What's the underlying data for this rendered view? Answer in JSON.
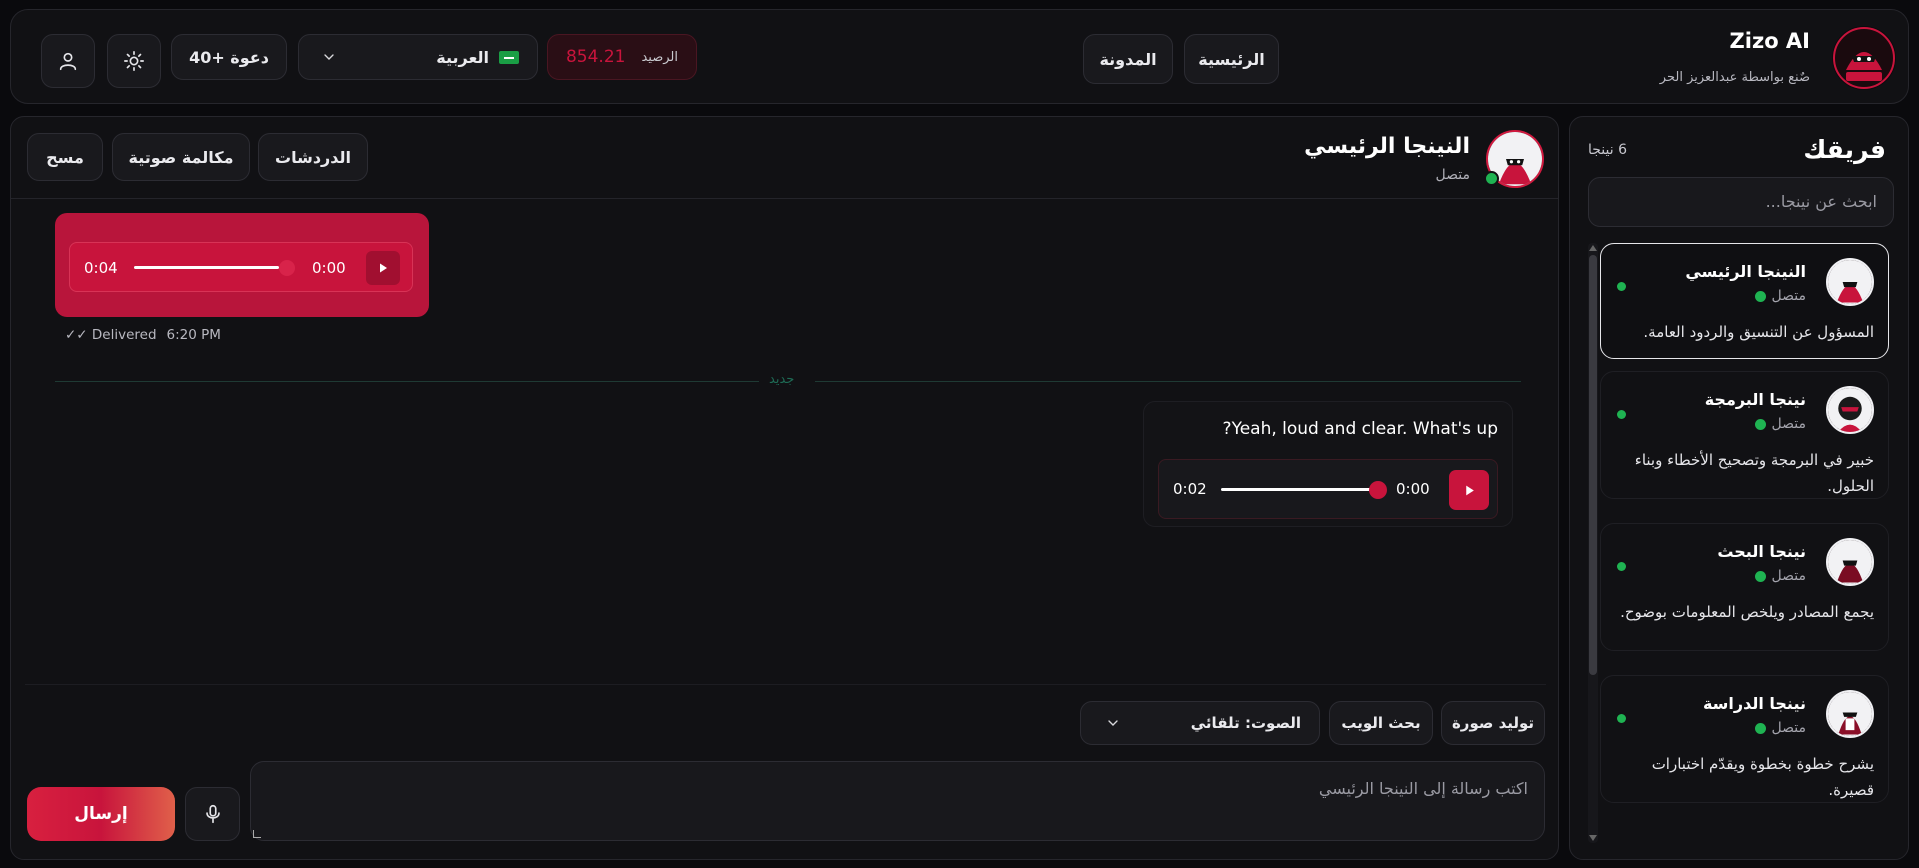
{
  "brand": {
    "name": "Zizo AI",
    "tagline": "صٌنع بواسطة عبدالعزيز الحر",
    "logo_text": "Zizo AI"
  },
  "nav": {
    "home": "الرئيسية",
    "blog": "المدونة"
  },
  "balance": {
    "label": "الرصيد",
    "value": "854.21"
  },
  "language": {
    "selected": "العربية",
    "flag": "saudi-flag"
  },
  "invite": "دعوة +40",
  "icons": {
    "theme": "sun-icon",
    "profile": "user-icon"
  },
  "chat": {
    "agent_name": "النينجا الرئيسي",
    "agent_status": "متصل",
    "actions": {
      "chats": "الدردشات",
      "voice_call": "مكالمة صوتية",
      "clear": "مسح"
    },
    "messages": [
      {
        "kind": "user-voice",
        "current": "0:00",
        "duration": "0:04",
        "progress": 0.05,
        "meta_time": "6:20 PM",
        "meta_status": "✓✓ Delivered"
      },
      {
        "kind": "agent-voice",
        "text": "Yeah, loud and clear. What's up?",
        "current": "0:00",
        "duration": "0:02",
        "progress": 0.0
      }
    ],
    "divider_label": "جديد",
    "tools": {
      "generate_image": "توليد صورة",
      "web_search": "بحث الويب",
      "voice_select": "الصوت: تلقائي"
    },
    "input_placeholder": "اكتب رسالة إلى النينجا الرئيسي",
    "send": "إرسال"
  },
  "team": {
    "title": "فريقك",
    "count": "6 نينجا",
    "search_placeholder": "ابحث عن نينجا...",
    "members": [
      {
        "name": "النينجا الرئيسي",
        "status": "متصل",
        "desc": "المسؤول عن التنسيق والردود العامة."
      },
      {
        "name": "نينجا البرمجة",
        "status": "متصل",
        "desc": "خبير في البرمجة وتصحيح الأخطاء وبناء الحلول."
      },
      {
        "name": "نينجا البحث",
        "status": "متصل",
        "desc": "يجمع المصادر ويلخص المعلومات بوضوح."
      },
      {
        "name": "نينجا الدراسة",
        "status": "متصل",
        "desc": "يشرح خطوة بخطوة ويقدّم اختبارات قصيرة."
      }
    ]
  },
  "colors": {
    "accent": "#c8143c",
    "accent_dark": "#a10f30",
    "online": "#1fb352",
    "send_gradient_end": "#e0604a"
  }
}
